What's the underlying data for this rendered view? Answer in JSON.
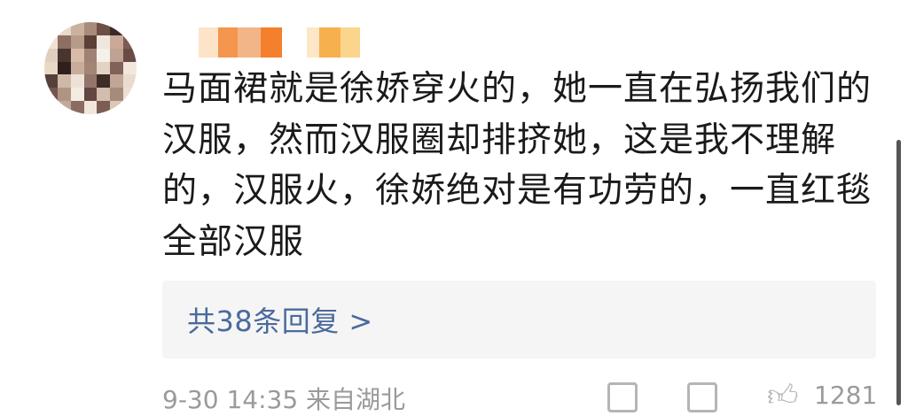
{
  "comment": {
    "lines": [
      "马面裙就是徐娇穿火的，她一直在弘扬我们的",
      "汉服，然而汉服圈却排挤她，这是我不理解",
      "的，汉服火，徐娇绝对是有功劳的，一直红毯",
      "全部汉服"
    ]
  },
  "replies": {
    "label": "共38条回复 >"
  },
  "footer": {
    "meta": "9-30 14:35 来自湖北",
    "like_count": "1281"
  },
  "icons": {
    "share": "share-icon",
    "comment": "comment-icon",
    "like": "thumbs-up-icon"
  },
  "colors": {
    "link": "#4a6a9c",
    "text": "#1a1a1a",
    "muted": "#9a9a9a",
    "reply_bg": "#f5f5f5"
  }
}
